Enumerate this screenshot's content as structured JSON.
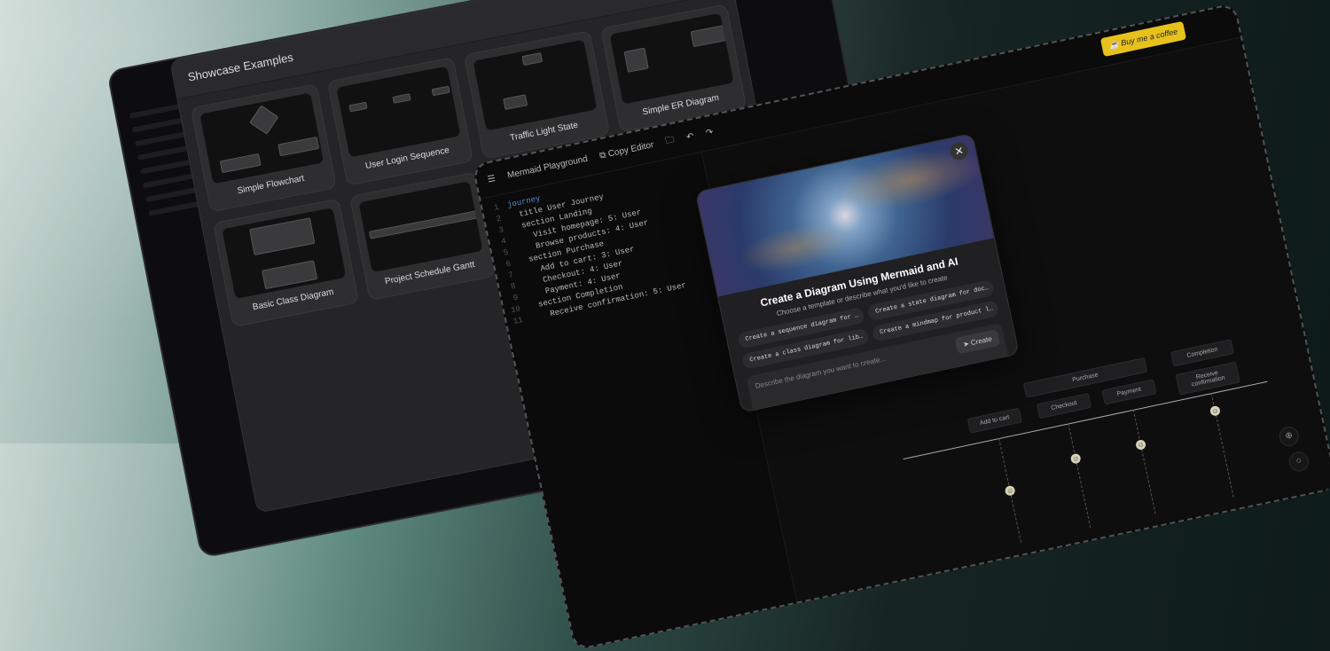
{
  "showcase": {
    "title": "Showcase Examples",
    "cards": [
      "Simple Flowchart",
      "User Login Sequence",
      "Traffic Light State",
      "Simple ER Diagram",
      "Basic Class Diagram",
      "Project Schedule Gantt",
      "",
      ""
    ]
  },
  "playground": {
    "title": "Mermaid Playground",
    "copy_label": "Copy Editor",
    "coffee_label": "Buy me a coffee",
    "code": [
      "journey",
      "  title User Journey",
      "  section Landing",
      "    Visit homepage: 5: User",
      "    Browse products: 4: User",
      "  section Purchase",
      "    Add to cart: 3: User",
      "    Checkout: 4: User",
      "    Payment: 4: User",
      "  section Completion",
      "    Receive confirmation: 5: User"
    ]
  },
  "modal": {
    "close": "✕",
    "title": "Create a Diagram Using Mermaid and AI",
    "subtitle": "Choose a template or describe what you'd like to create",
    "suggestions": [
      "Create a sequence diagram for …",
      "Create a state diagram for doc…",
      "Create a class diagram for lib…",
      "Create a mindmap for product l…"
    ],
    "placeholder": "Describe the diagram you want to create...",
    "create_label": "Create"
  },
  "journey": {
    "sections": [
      "Purchase",
      "Completion"
    ],
    "tasks": [
      "Add to cart",
      "Checkout",
      "Payment",
      "Receive confirmation"
    ]
  }
}
